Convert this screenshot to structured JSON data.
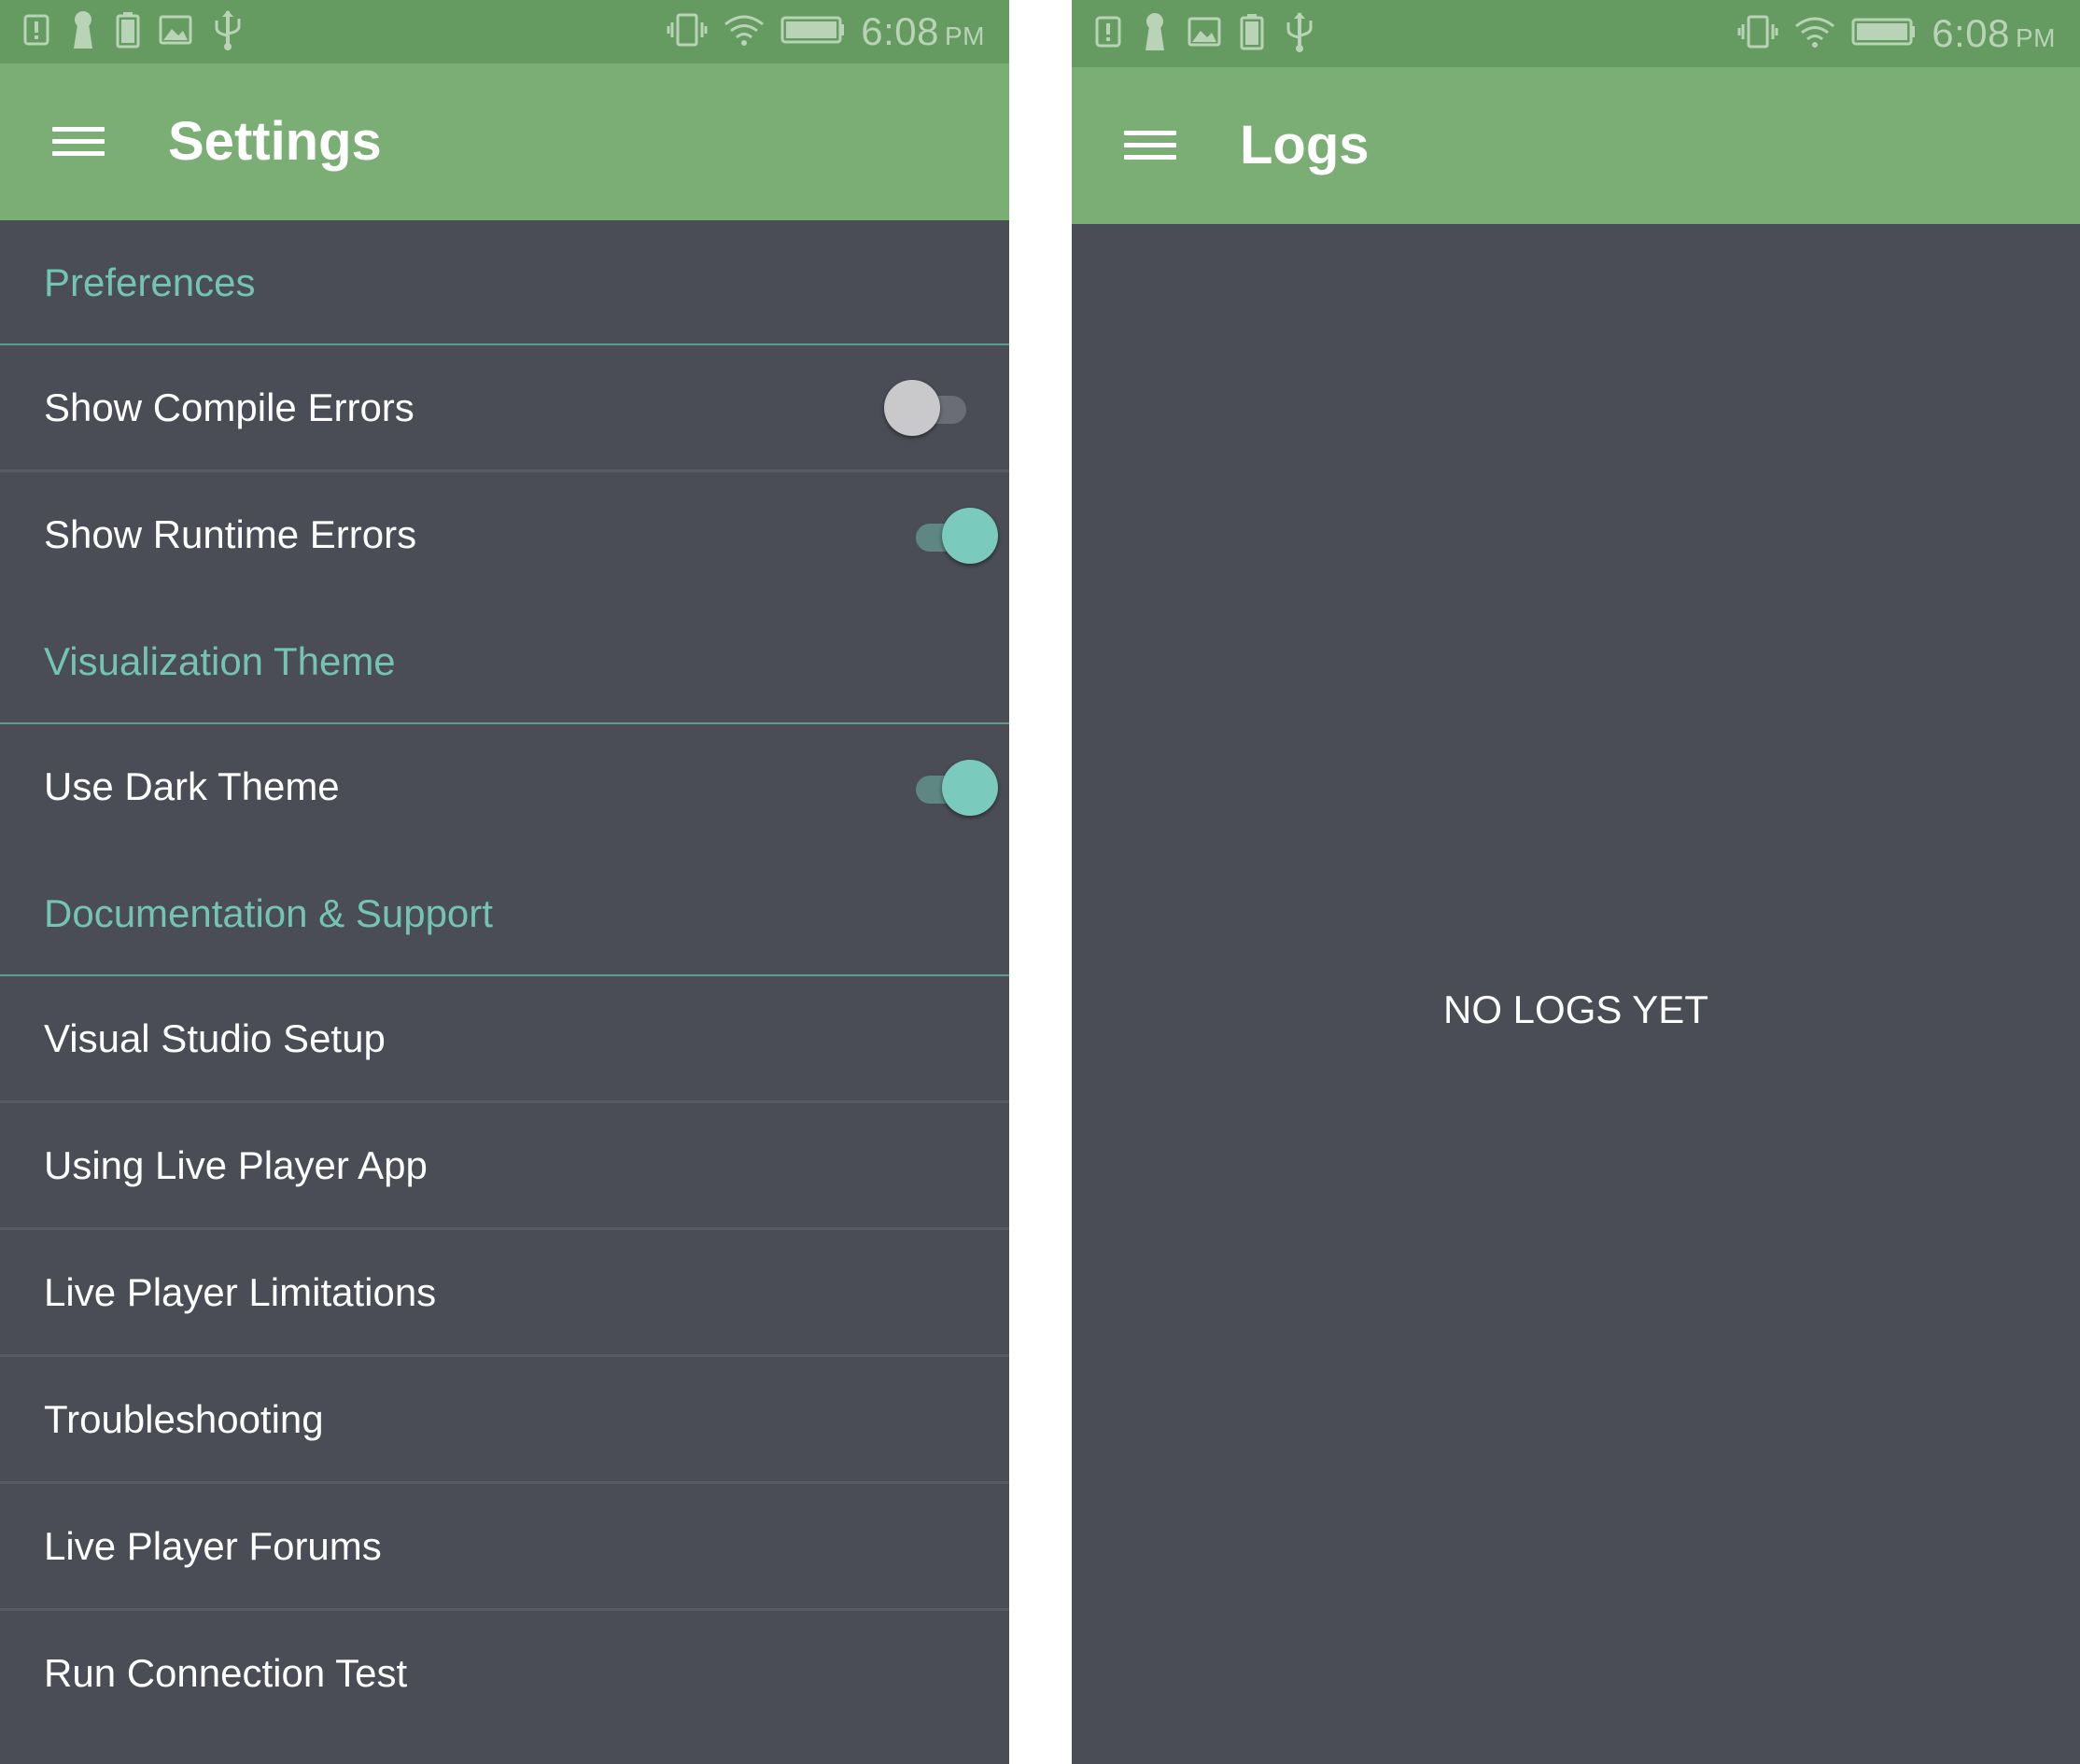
{
  "status_bar": {
    "time": "6:08",
    "ampm": "PM",
    "icons_left": [
      "alert-icon",
      "keyhole-icon",
      "battery-full-icon",
      "image-icon",
      "usb-icon"
    ],
    "icons_right": [
      "vibrate-icon",
      "wifi-icon",
      "battery-icon"
    ]
  },
  "settings_screen": {
    "title": "Settings",
    "sections": [
      {
        "header": "Preferences",
        "items": [
          {
            "label": "Show Compile Errors",
            "toggle": false
          },
          {
            "label": "Show Runtime Errors",
            "toggle": true
          }
        ]
      },
      {
        "header": "Visualization Theme",
        "items": [
          {
            "label": "Use Dark Theme",
            "toggle": true
          }
        ]
      },
      {
        "header": "Documentation & Support",
        "items": [
          {
            "label": "Visual Studio Setup"
          },
          {
            "label": "Using Live Player App"
          },
          {
            "label": "Live Player Limitations"
          },
          {
            "label": "Troubleshooting"
          },
          {
            "label": "Live Player Forums"
          },
          {
            "label": "Run Connection Test"
          }
        ]
      }
    ]
  },
  "logs_screen": {
    "title": "Logs",
    "empty_message": "NO LOGS YET"
  },
  "colors": {
    "status_bar": "#659b61",
    "toolbar": "#7aae74",
    "background": "#4a4c56",
    "accent": "#74c4b3",
    "toggle_on": "#7acabe"
  }
}
